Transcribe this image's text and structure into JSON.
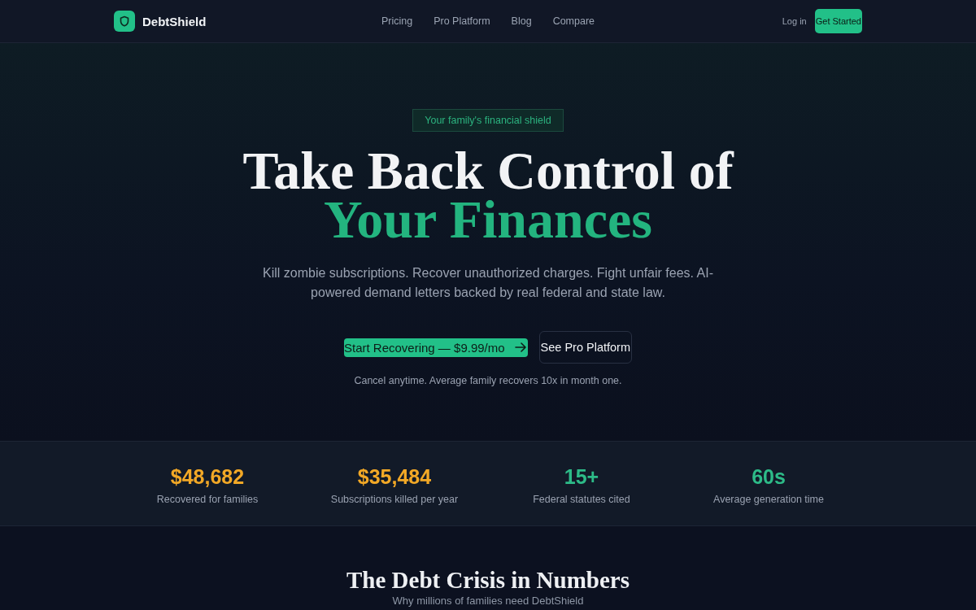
{
  "nav": {
    "brand": "DebtShield",
    "links": [
      "Pricing",
      "Pro Platform",
      "Blog",
      "Compare"
    ],
    "login": "Log in",
    "cta": "Get Started"
  },
  "hero": {
    "badge": "Your family's financial shield",
    "headline": "Take Back Control of",
    "headline_highlight": "Your Finances",
    "subtitle": "Kill zombie subscriptions. Recover unauthorized charges. Fight unfair fees. AI-powered demand letters backed by real federal and state law.",
    "primary_button": "Start Recovering — $9.99/mo",
    "secondary_button": "See Pro Platform",
    "note": "Cancel anytime. Average family recovers 10x in month one."
  },
  "stats": [
    {
      "value": "$48,682",
      "label": "Recovered for families",
      "color": "#f2a826"
    },
    {
      "value": "$35,484",
      "label": "Subscriptions killed per year",
      "color": "#f2a826"
    },
    {
      "value": "15+",
      "label": "Federal statutes cited",
      "color": "#2dbb88"
    },
    {
      "value": "60s",
      "label": "Average generation time",
      "color": "#2dbb88"
    }
  ],
  "section": {
    "title": "The Debt Crisis in Numbers",
    "subtitle": "Why millions of families need DebtShield"
  }
}
